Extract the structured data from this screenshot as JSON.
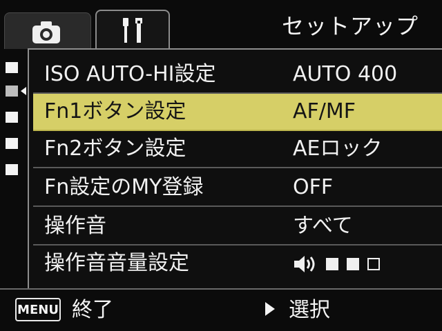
{
  "header": {
    "title": "セットアップ",
    "tabs": [
      {
        "name": "camera-tab",
        "icon": "camera-icon"
      },
      {
        "name": "setup-tab",
        "icon": "wrench-screwdriver-icon",
        "active": true
      }
    ]
  },
  "pages": {
    "count": 5,
    "active_index": 1
  },
  "menu": {
    "selected_index": 1,
    "items": [
      {
        "label": "ISO AUTO-HI設定",
        "value": "AUTO 400"
      },
      {
        "label": "Fn1ボタン設定",
        "value": "AF/MF"
      },
      {
        "label": "Fn2ボタン設定",
        "value": "AEロック"
      },
      {
        "label": "Fn設定のMY登録",
        "value": "OFF"
      },
      {
        "label": "操作音",
        "value": "すべて"
      },
      {
        "label": "操作音音量設定",
        "value": ""
      }
    ],
    "volume": {
      "level": 2,
      "max": 3,
      "icon": "speaker-icon"
    }
  },
  "footer": {
    "menu_key": "MENU",
    "exit_label": "終了",
    "select_label": "選択"
  },
  "colors": {
    "background": "#0b0b0b",
    "selected_row": "#d6cf67",
    "text": "#f1f1f1",
    "border": "#8e8e8e"
  }
}
